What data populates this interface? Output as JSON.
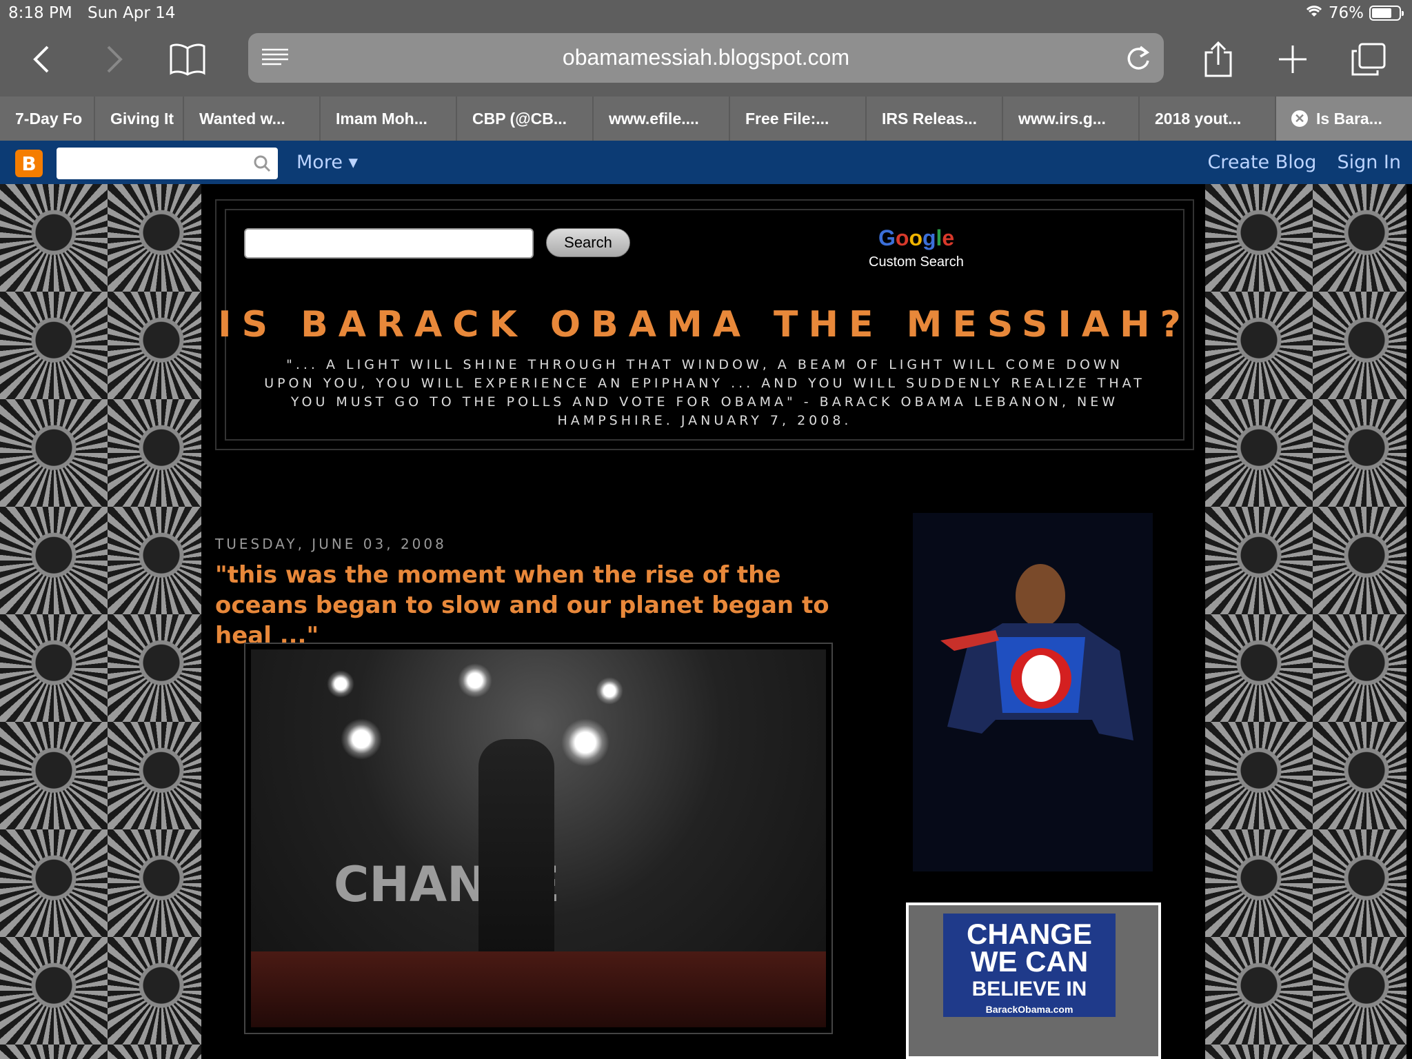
{
  "status": {
    "time": "8:18 PM",
    "date": "Sun Apr 14",
    "battery": "76%",
    "battery_level": 0.76
  },
  "toolbar": {
    "url": "obamamessiah.blogspot.com"
  },
  "tabs": [
    {
      "label": "7-Day Fo"
    },
    {
      "label": "Giving It"
    },
    {
      "label": "Wanted w..."
    },
    {
      "label": "Imam Moh..."
    },
    {
      "label": "CBP (@CB..."
    },
    {
      "label": "www.efile...."
    },
    {
      "label": "Free File:..."
    },
    {
      "label": "IRS Releas..."
    },
    {
      "label": "www.irs.g..."
    },
    {
      "label": "2018 yout..."
    },
    {
      "label": "Is Bara..."
    }
  ],
  "blogger": {
    "more": "More",
    "create_blog": "Create Blog",
    "sign_in": "Sign In"
  },
  "search": {
    "button": "Search",
    "google": "Google",
    "custom": "Custom Search"
  },
  "blog": {
    "title": "IS BARACK OBAMA THE MESSIAH?",
    "description": "\"... A LIGHT WILL SHINE THROUGH THAT WINDOW, A BEAM OF LIGHT WILL COME DOWN UPON YOU, YOU WILL EXPERIENCE AN EPIPHANY ... AND YOU WILL SUDDENLY REALIZE THAT YOU MUST GO TO THE POLLS AND VOTE FOR OBAMA\" - BARACK OBAMA LEBANON, NEW HAMPSHIRE. JANUARY 7, 2008."
  },
  "post": {
    "date": "TUESDAY, JUNE 03, 2008",
    "title": "\"this was the moment when the rise of the oceans began to slow and our planet began to heal ...\"",
    "image_text": "CHANGE"
  },
  "sidebar": {
    "sign_line1": "CHANGE",
    "sign_line2": "WE CAN",
    "sign_line3": "BELIEVE IN",
    "sign_url": "BarackObama.com"
  }
}
